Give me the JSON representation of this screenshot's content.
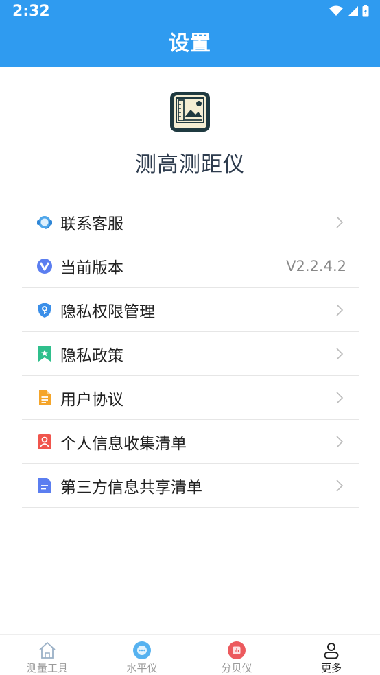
{
  "status_bar": {
    "time": "2:32"
  },
  "app_bar": {
    "title": "设置"
  },
  "header": {
    "app_name": "测高测距仪"
  },
  "menu": {
    "items": [
      {
        "label": "联系客服",
        "icon": "headset-icon"
      },
      {
        "label": "当前版本",
        "icon": "version-v-icon",
        "value": "V2.2.4.2"
      },
      {
        "label": "隐私权限管理",
        "icon": "shield-key-icon"
      },
      {
        "label": "隐私政策",
        "icon": "bookmark-star-icon"
      },
      {
        "label": "用户协议",
        "icon": "document-icon"
      },
      {
        "label": "个人信息收集清单",
        "icon": "person-card-icon"
      },
      {
        "label": "第三方信息共享清单",
        "icon": "file-list-icon"
      }
    ]
  },
  "tab_bar": {
    "tabs": [
      {
        "label": "测量工具",
        "icon": "home-icon",
        "active": false
      },
      {
        "label": "水平仪",
        "icon": "level-bubble-icon",
        "active": false
      },
      {
        "label": "分贝仪",
        "icon": "decibel-icon",
        "active": false
      },
      {
        "label": "更多",
        "icon": "user-icon",
        "active": true
      }
    ]
  },
  "colors": {
    "primary": "#2f9bf0",
    "divider": "#e6e6e6",
    "text": "#222222",
    "muted": "#888888"
  }
}
